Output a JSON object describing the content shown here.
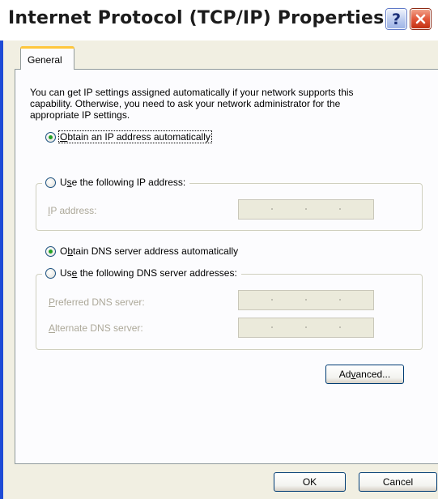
{
  "window": {
    "title": "Internet Protocol (TCP/IP) Properties",
    "help_glyph": "?",
    "close_icon": "close-icon"
  },
  "tabs": [
    {
      "label": "General",
      "selected": true
    }
  ],
  "intro_text": "You can get IP settings assigned automatically if your network supports this capability. Otherwise, you need to ask your network administrator for the appropriate IP settings.",
  "ip_section": {
    "auto_option": {
      "pre": "",
      "key": "O",
      "post": "btain an IP address automatically",
      "checked": true
    },
    "manual_option": {
      "pre": "U",
      "key": "s",
      "post": "e the following IP address:",
      "checked": false
    },
    "ip_field": {
      "pre": "",
      "key": "I",
      "post": "P address:",
      "value": ". . ."
    }
  },
  "dns_section": {
    "auto_option": {
      "pre": "O",
      "key": "b",
      "post": "tain DNS server address automatically",
      "checked": true
    },
    "manual_option": {
      "pre": "Us",
      "key": "e",
      "post": " the following DNS server addresses:",
      "checked": false
    },
    "preferred_field": {
      "pre": "",
      "key": "P",
      "post": "referred DNS server:",
      "value": ". . ."
    },
    "alternate_field": {
      "pre": "",
      "key": "A",
      "post": "lternate DNS server:",
      "value": ". . ."
    }
  },
  "buttons": {
    "advanced": {
      "pre": "Ad",
      "key": "v",
      "post": "anced..."
    },
    "ok": "OK",
    "cancel": "Cancel"
  },
  "colors": {
    "title_bar_background": "#ffffff",
    "dialog_face": "#f1efe2",
    "tab_highlight": "#ffc73c",
    "radio_selected": "#21a121",
    "close_button": "#e2573a",
    "window_frame": "#1e4bd6"
  }
}
